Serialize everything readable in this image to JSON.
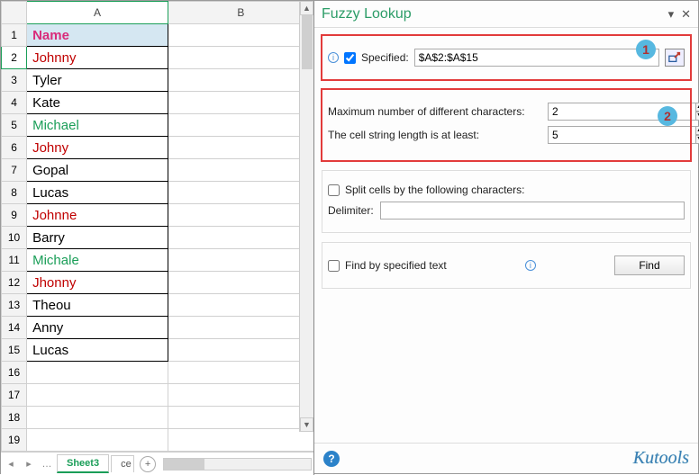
{
  "sheet": {
    "colA_label": "A",
    "colB_label": "B",
    "rows": [
      {
        "n": "1",
        "v": "Name"
      },
      {
        "n": "2",
        "v": "Johnny"
      },
      {
        "n": "3",
        "v": "Tyler"
      },
      {
        "n": "4",
        "v": "Kate"
      },
      {
        "n": "5",
        "v": "Michael"
      },
      {
        "n": "6",
        "v": "Johny"
      },
      {
        "n": "7",
        "v": "Gopal"
      },
      {
        "n": "8",
        "v": "Lucas"
      },
      {
        "n": "9",
        "v": "Johnne"
      },
      {
        "n": "10",
        "v": "Barry"
      },
      {
        "n": "11",
        "v": "Michale"
      },
      {
        "n": "12",
        "v": "Jhonny"
      },
      {
        "n": "13",
        "v": "Theou"
      },
      {
        "n": "14",
        "v": "Anny"
      },
      {
        "n": "15",
        "v": "Lucas"
      },
      {
        "n": "16",
        "v": ""
      },
      {
        "n": "17",
        "v": ""
      },
      {
        "n": "18",
        "v": ""
      },
      {
        "n": "19",
        "v": ""
      }
    ],
    "tabs": {
      "nav_ellipsis": "…",
      "active": "Sheet3",
      "next_partial": "ce",
      "plus": "+"
    }
  },
  "panel": {
    "title": "Fuzzy Lookup",
    "pin_glyph": "▾",
    "close_glyph": "✕",
    "specified_label": "Specified:",
    "range_value": "$A$2:$A$15",
    "max_diff_label": "Maximum number of different characters:",
    "max_diff_value": "2",
    "min_len_label": "The cell string length is at least:",
    "min_len_value": "5",
    "split_label": "Split cells by the following characters:",
    "delimiter_label": "Delimiter:",
    "delimiter_value": "",
    "find_text_label": "Find by specified text",
    "find_button": "Find",
    "badge1": "1",
    "badge2": "2",
    "help_glyph": "?",
    "brand": "Kutools"
  }
}
